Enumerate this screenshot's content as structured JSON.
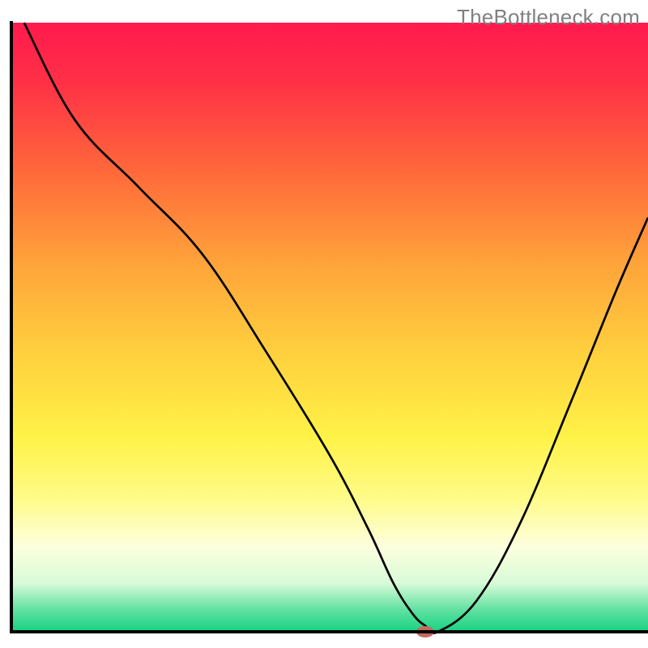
{
  "watermark": "TheBottleneck.com",
  "chart_data": {
    "type": "line",
    "title": "",
    "xlabel": "",
    "ylabel": "",
    "xlim": [
      0,
      100
    ],
    "ylim": [
      0,
      100
    ],
    "axes_visible": false,
    "grid": false,
    "background_gradient": {
      "stops": [
        {
          "offset": 0.0,
          "color": "#ff1a4e"
        },
        {
          "offset": 0.1,
          "color": "#ff3146"
        },
        {
          "offset": 0.25,
          "color": "#ff6b3a"
        },
        {
          "offset": 0.4,
          "color": "#ffa53a"
        },
        {
          "offset": 0.55,
          "color": "#ffd23e"
        },
        {
          "offset": 0.68,
          "color": "#fff247"
        },
        {
          "offset": 0.78,
          "color": "#fffb87"
        },
        {
          "offset": 0.86,
          "color": "#fdffde"
        },
        {
          "offset": 0.92,
          "color": "#d8fbd8"
        },
        {
          "offset": 0.965,
          "color": "#5ee0a0"
        },
        {
          "offset": 1.0,
          "color": "#17d282"
        }
      ]
    },
    "series": [
      {
        "name": "bottleneck-curve",
        "color": "#000000",
        "width": 2.7,
        "x": [
          2,
          10,
          20,
          30,
          40,
          50,
          56,
          60,
          63,
          65,
          67,
          73,
          80,
          88,
          95,
          100
        ],
        "y": [
          100,
          84,
          73,
          62,
          46,
          29,
          17,
          8,
          3,
          1,
          0,
          5,
          18,
          38,
          56,
          68
        ]
      }
    ],
    "marker": {
      "name": "optimal-point",
      "x": 65,
      "y": 0,
      "color": "#c46a5e",
      "rx": 11,
      "ry": 7
    },
    "frame": {
      "color": "#000000",
      "width": 4
    }
  }
}
